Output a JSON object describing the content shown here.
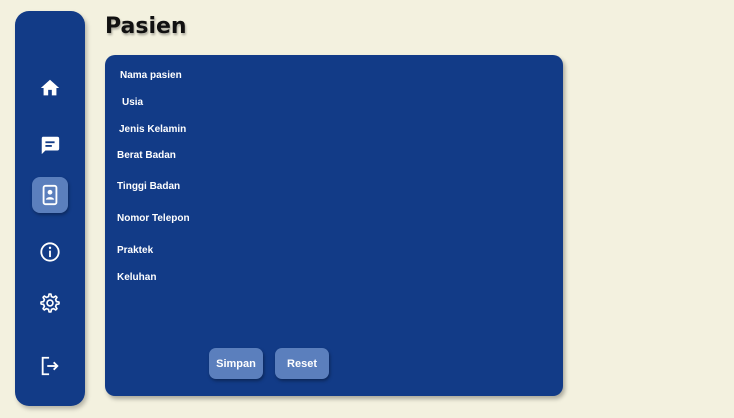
{
  "sidebar": {
    "items": [
      {
        "icon": "home-icon",
        "active": false
      },
      {
        "icon": "chat-icon",
        "active": false
      },
      {
        "icon": "patient-card-icon",
        "active": true
      },
      {
        "icon": "info-icon",
        "active": false
      },
      {
        "icon": "gear-icon",
        "active": false
      },
      {
        "icon": "logout-icon",
        "active": false
      }
    ],
    "accent": "#123b87",
    "active_color": "#5b7fbd"
  },
  "page": {
    "title": "Pasien"
  },
  "form": {
    "fields": [
      {
        "label": "Nama pasien"
      },
      {
        "label": "Usia"
      },
      {
        "label": "Jenis Kelamin"
      },
      {
        "label": "Berat Badan"
      },
      {
        "label": "Tinggi Badan"
      },
      {
        "label": "Nomor Telepon"
      },
      {
        "label": "Praktek"
      },
      {
        "label": "Keluhan"
      }
    ],
    "save_label": "Simpan",
    "reset_label": "Reset"
  },
  "colors": {
    "background": "#f3f1df",
    "panel": "#123b87",
    "button": "#5b7fbd"
  }
}
